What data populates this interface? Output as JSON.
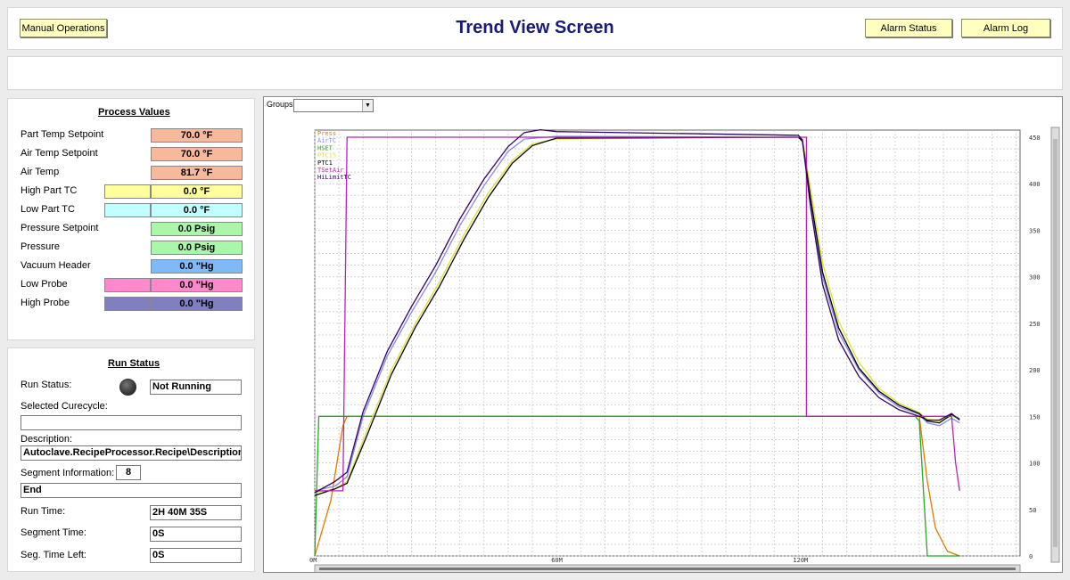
{
  "header": {
    "title": "Trend View Screen",
    "manual_operations_label": "Manual Operations",
    "alarm_status_label": "Alarm Status",
    "alarm_log_label": "Alarm Log"
  },
  "process_values": {
    "title": "Process Values",
    "rows": [
      {
        "label": "Part Temp Setpoint",
        "value": "70.0 °F",
        "color": "#f7b99c",
        "swatch": null
      },
      {
        "label": "Air Temp Setpoint",
        "value": "70.0 °F",
        "color": "#f7b99c",
        "swatch": null
      },
      {
        "label": "Air Temp",
        "value": "81.7 °F",
        "color": "#f7b99c",
        "swatch": null
      },
      {
        "label": "High Part TC",
        "value": "0.0 °F",
        "color": "#ffff9c",
        "swatch": "#ffff9c"
      },
      {
        "label": "Low Part TC",
        "value": "0.0 °F",
        "color": "#c0ffff",
        "swatch": "#c0ffff"
      },
      {
        "label": "Pressure Setpoint",
        "value": "0.0 Psig",
        "color": "#a9f7a9",
        "swatch": null
      },
      {
        "label": "Pressure",
        "value": "0.0 Psig",
        "color": "#a9f7a9",
        "swatch": null
      },
      {
        "label": "Vacuum Header",
        "value": "0.0 \"Hg",
        "color": "#7fb9f7",
        "swatch": null
      },
      {
        "label": "Low Probe",
        "value": "0.0 \"Hg",
        "color": "#ff88cc",
        "swatch": "#ff88cc"
      },
      {
        "label": "High Probe",
        "value": "0.0 \"Hg",
        "color": "#8080c0",
        "swatch": "#8080c0"
      }
    ]
  },
  "run_status": {
    "title": "Run Status",
    "run_status_label": "Run Status:",
    "run_status_value": "Not Running",
    "selected_curecycle_label": "Selected Curecycle:",
    "selected_curecycle_value": "",
    "description_label": "Description:",
    "description_value": "Autoclave.RecipeProcessor.Recipe\\Description",
    "segment_info_label": "Segment Information:",
    "segment_info_value": "8",
    "segment_name_value": "End",
    "run_time_label": "Run Time:",
    "run_time_value": "2H 40M 35S",
    "segment_time_label": "Segment Time:",
    "segment_time_value": "0S",
    "seg_time_left_label": "Seg. Time Left:",
    "seg_time_left_value": "0S"
  },
  "groups": {
    "label": "Groups",
    "value": ""
  },
  "chart_data": {
    "type": "line",
    "xlabel": "",
    "ylabel": "",
    "x_ticks": [
      {
        "v": 0,
        "label": "0M"
      },
      {
        "v": 60,
        "label": "60M"
      },
      {
        "v": 120,
        "label": "120M"
      }
    ],
    "xlim": [
      0,
      175
    ],
    "ylim": [
      0,
      450
    ],
    "y_ticks": [
      0,
      50,
      100,
      150,
      200,
      250,
      300,
      350,
      400,
      450
    ],
    "grid": true,
    "legend_position": "top-left",
    "series": [
      {
        "name": "Press",
        "color": "#e07a00",
        "points": [
          [
            0,
            0
          ],
          [
            4,
            60
          ],
          [
            7,
            140
          ],
          [
            8,
            150
          ],
          [
            150,
            150
          ],
          [
            152,
            80
          ],
          [
            154,
            30
          ],
          [
            157,
            5
          ],
          [
            160,
            0
          ]
        ]
      },
      {
        "name": "AirTC",
        "color": "#8888ee",
        "points": [
          [
            0,
            70
          ],
          [
            5,
            75
          ],
          [
            8,
            85
          ],
          [
            12,
            150
          ],
          [
            18,
            215
          ],
          [
            24,
            262
          ],
          [
            30,
            305
          ],
          [
            36,
            355
          ],
          [
            42,
            398
          ],
          [
            48,
            435
          ],
          [
            52,
            448
          ],
          [
            60,
            451
          ],
          [
            120,
            450
          ],
          [
            121,
            445
          ],
          [
            123,
            380
          ],
          [
            126,
            300
          ],
          [
            130,
            240
          ],
          [
            135,
            200
          ],
          [
            140,
            175
          ],
          [
            145,
            160
          ],
          [
            150,
            152
          ],
          [
            152,
            143
          ],
          [
            155,
            140
          ],
          [
            158,
            148
          ],
          [
            160,
            143
          ]
        ]
      },
      {
        "name": "HSET",
        "color": "#22aa22",
        "points": [
          [
            0,
            0
          ],
          [
            1,
            150
          ],
          [
            149,
            150
          ],
          [
            150,
            145
          ],
          [
            152,
            0
          ],
          [
            160,
            0
          ]
        ]
      },
      {
        "name": "PTC15",
        "color": "#e0e030",
        "points": [
          [
            0,
            68
          ],
          [
            5,
            72
          ],
          [
            8,
            80
          ],
          [
            13,
            135
          ],
          [
            19,
            200
          ],
          [
            25,
            250
          ],
          [
            31,
            295
          ],
          [
            37,
            345
          ],
          [
            43,
            390
          ],
          [
            49,
            425
          ],
          [
            54,
            443
          ],
          [
            60,
            448
          ],
          [
            120,
            450
          ],
          [
            121,
            448
          ],
          [
            123,
            395
          ],
          [
            126,
            315
          ],
          [
            130,
            252
          ],
          [
            135,
            208
          ],
          [
            140,
            180
          ],
          [
            145,
            164
          ],
          [
            150,
            154
          ],
          [
            152,
            147
          ],
          [
            155,
            145
          ],
          [
            158,
            150
          ],
          [
            160,
            148
          ]
        ]
      },
      {
        "name": "PTC1",
        "color": "#000000",
        "points": [
          [
            0,
            65
          ],
          [
            5,
            72
          ],
          [
            8,
            78
          ],
          [
            13,
            130
          ],
          [
            19,
            195
          ],
          [
            25,
            246
          ],
          [
            31,
            290
          ],
          [
            37,
            340
          ],
          [
            43,
            385
          ],
          [
            49,
            422
          ],
          [
            54,
            441
          ],
          [
            60,
            449
          ],
          [
            120,
            450
          ],
          [
            121,
            446
          ],
          [
            123,
            385
          ],
          [
            126,
            305
          ],
          [
            130,
            245
          ],
          [
            135,
            202
          ],
          [
            140,
            177
          ],
          [
            145,
            162
          ],
          [
            150,
            153
          ],
          [
            152,
            145
          ],
          [
            155,
            143
          ],
          [
            158,
            152
          ],
          [
            160,
            147
          ]
        ]
      },
      {
        "name": "TSetAir",
        "color": "#bb22bb",
        "points": [
          [
            0,
            70
          ],
          [
            7,
            70
          ],
          [
            8,
            450
          ],
          [
            122,
            450
          ],
          [
            122,
            150
          ],
          [
            158,
            150
          ],
          [
            159,
            100
          ],
          [
            160,
            70
          ]
        ]
      },
      {
        "name": "HiLimitTC",
        "color": "#330066",
        "points": [
          [
            0,
            68
          ],
          [
            5,
            80
          ],
          [
            8,
            90
          ],
          [
            12,
            155
          ],
          [
            18,
            220
          ],
          [
            24,
            268
          ],
          [
            30,
            312
          ],
          [
            36,
            362
          ],
          [
            42,
            405
          ],
          [
            48,
            440
          ],
          [
            52,
            455
          ],
          [
            56,
            458
          ],
          [
            60,
            456
          ],
          [
            120,
            452
          ],
          [
            121,
            447
          ],
          [
            123,
            375
          ],
          [
            126,
            292
          ],
          [
            130,
            232
          ],
          [
            135,
            193
          ],
          [
            140,
            170
          ],
          [
            145,
            157
          ],
          [
            150,
            150
          ],
          [
            152,
            146
          ],
          [
            155,
            146
          ],
          [
            158,
            153
          ],
          [
            160,
            146
          ]
        ]
      }
    ]
  }
}
